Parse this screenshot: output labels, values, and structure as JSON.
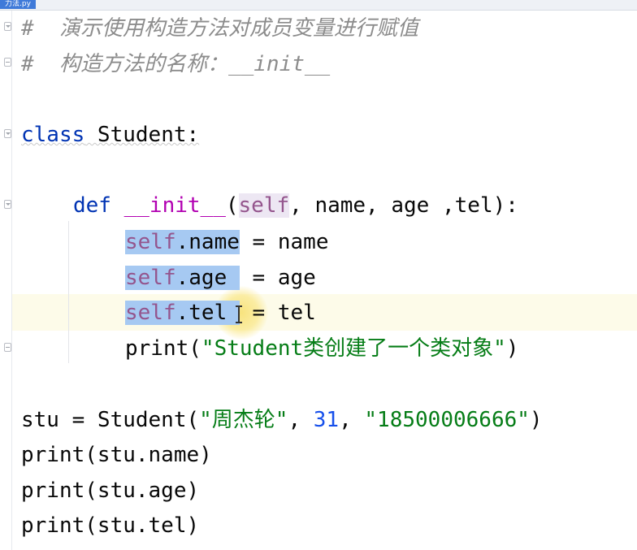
{
  "tab": {
    "title": "力法.py"
  },
  "code": {
    "comment1": "#  演示使用构造方法对成员变量进行赋值",
    "comment2": "#  构造方法的名称：__init__",
    "class_kw": "class",
    "class_name": " Student:",
    "def_kw": "def",
    "init_name": "__init__",
    "open_paren": "(",
    "self": "self",
    "params": ", name, age ,tel):",
    "line_name_self": "self",
    "line_name_attr": ".name",
    "line_name_rest": " = name",
    "line_age_self": "self",
    "line_age_attr": ".age",
    "line_age_rest": " = age",
    "line_tel_self": "self",
    "line_tel_attr": ".tel",
    "line_tel_rest": " = tel",
    "print_fn": "print(",
    "print_str": "\"Student类创建了一个类对象\"",
    "print_close": ")",
    "stu_assign": "stu = Student(",
    "arg_name": "\"周杰轮\"",
    "comma1": ", ",
    "arg_age": "31",
    "comma2": ", ",
    "arg_tel": "\"18500006666\"",
    "stu_close": ")",
    "print_name": "print(stu.name)",
    "print_age": "print(stu.age)",
    "print_tel": "print(stu.tel)"
  },
  "colors": {
    "keyword": "#0033b3",
    "dunder": "#b200b2",
    "self": "#94558d",
    "string": "#067d17",
    "number": "#1750eb",
    "comment": "#8c8c8c",
    "selection": "#a6c9f2",
    "caret_line": "#fdfbe9"
  },
  "icons": [
    "fold-open-icon",
    "fold-close-icon",
    "text-cursor-icon"
  ]
}
